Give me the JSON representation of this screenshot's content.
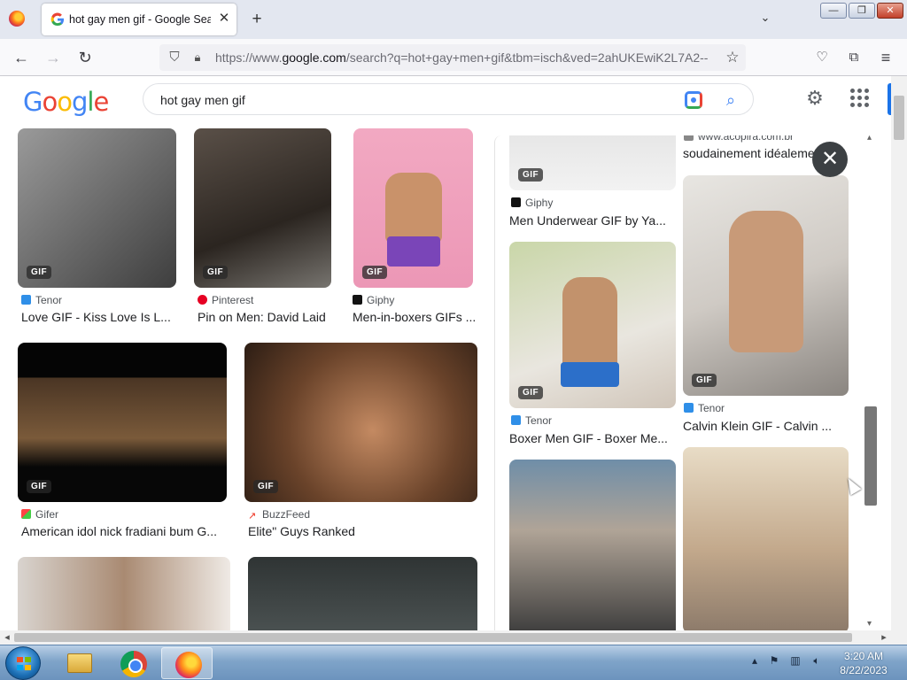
{
  "browser": {
    "tab_title": "hot gay men gif - Google Search",
    "tab_close": "✕",
    "new_tab": "+",
    "tab_list": "⌄",
    "url_prefix": "https://www.",
    "url_domain": "google.com",
    "url_rest": "/search?q=hot+gay+men+gif&tbm=isch&ved=2ahUKEwiK2L7A2--",
    "window_buttons": {
      "minimize": "—",
      "restore": "❐",
      "close": "✕"
    },
    "nav": {
      "back": "←",
      "forward": "→",
      "reload": "↻"
    }
  },
  "google": {
    "logo_letters": [
      "G",
      "o",
      "o",
      "g",
      "l",
      "e"
    ],
    "logo_colors": [
      "#4285f4",
      "#ea4335",
      "#fbbc05",
      "#4285f4",
      "#34a853",
      "#ea4335"
    ],
    "query": "hot gay men gif"
  },
  "results": [
    {
      "source": "Tenor",
      "caption": "Love GIF - Kiss Love Is L...",
      "badge": "GIF",
      "source_color": "#2f8fe8"
    },
    {
      "source": "Pinterest",
      "caption": "Pin on Men: David Laid",
      "badge": "GIF",
      "source_color": "#e60023"
    },
    {
      "source": "Giphy",
      "caption": "Men-in-boxers GIFs ...",
      "badge": "GIF",
      "source_color": "#121212"
    },
    {
      "source": "Gifer",
      "caption": "American idol nick fradiani bum G...",
      "badge": "GIF",
      "source_color": "#6abf4b"
    },
    {
      "source": "BuzzFeed",
      "caption": "Elite\" Guys Ranked",
      "badge": "GIF",
      "source_color": "#e32"
    }
  ],
  "panel": {
    "close_icon": "✕",
    "items": [
      {
        "source": "Giphy",
        "caption": "Men Underwear GIF by Ya...",
        "badge": "GIF",
        "source_color": "#121212"
      },
      {
        "source": "www.acopira.com.br",
        "caption": "soudainement idéalement",
        "badge": "",
        "source_color": "#888888"
      },
      {
        "source": "Tenor",
        "caption": "Boxer Men GIF - Boxer Me...",
        "badge": "GIF",
        "source_color": "#2f8fe8"
      },
      {
        "source": "Tenor",
        "caption": "Calvin Klein GIF - Calvin ...",
        "badge": "GIF",
        "source_color": "#2f8fe8"
      }
    ]
  },
  "taskbar": {
    "time": "3:20 AM",
    "date": "8/22/2023"
  }
}
